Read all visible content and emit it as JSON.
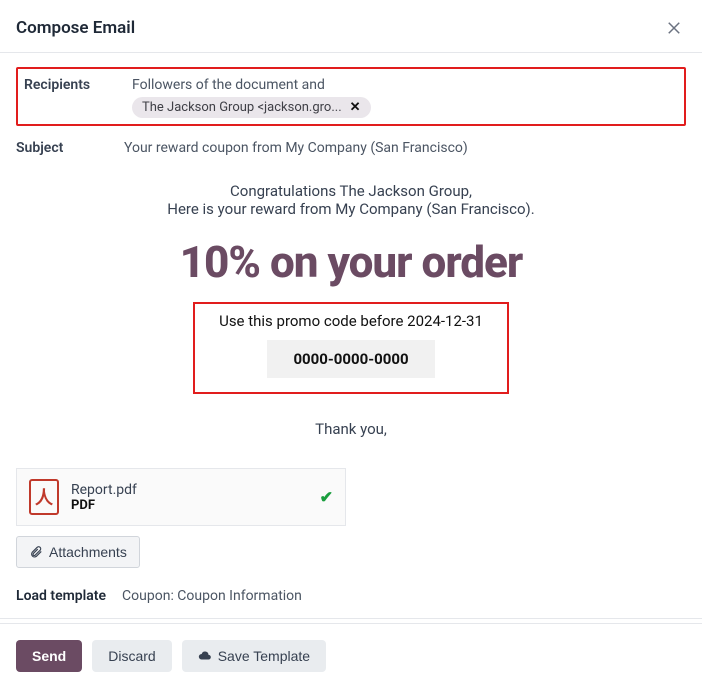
{
  "header": {
    "title": "Compose Email"
  },
  "recipients": {
    "label": "Recipients",
    "text": "Followers of the document and",
    "chip": "The Jackson Group <jackson.gro..."
  },
  "subject": {
    "label": "Subject",
    "value": "Your reward coupon from My Company (San Francisco)"
  },
  "body": {
    "line1": "Congratulations The Jackson Group,",
    "line2": "Here is your reward from My Company (San Francisco).",
    "hero": "10% on your order",
    "promo_text": "Use this promo code before 2024-12-31",
    "promo_code": "0000-0000-0000",
    "thank": "Thank you,"
  },
  "attachment": {
    "filename": "Report.pdf",
    "filetype": "PDF",
    "button": "Attachments"
  },
  "template": {
    "label": "Load template",
    "value": "Coupon: Coupon Information"
  },
  "footer": {
    "send": "Send",
    "discard": "Discard",
    "save_template": "Save Template"
  }
}
